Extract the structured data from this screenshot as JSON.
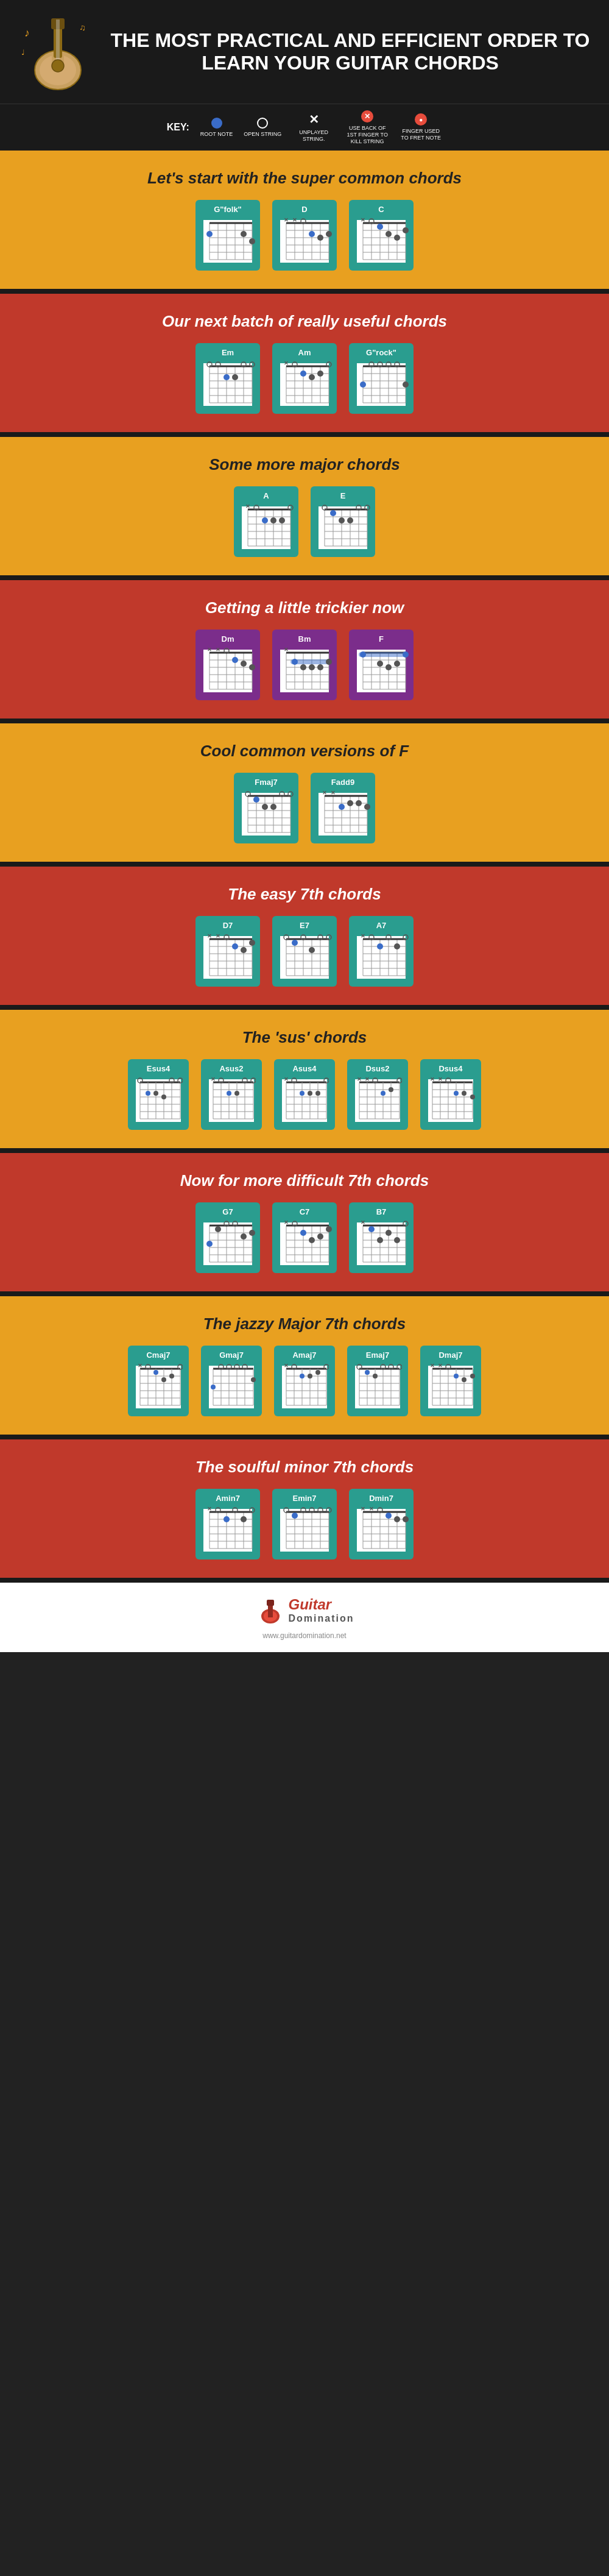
{
  "header": {
    "title": "THE MOST PRACTICAL AND EFFICIENT ORDER TO LEARN YOUR GUITAR CHORDS"
  },
  "key": {
    "label": "KEY:",
    "items": [
      {
        "symbol": "root",
        "label": "ROOT NOTE"
      },
      {
        "symbol": "open",
        "label": "OPEN STRING"
      },
      {
        "symbol": "X",
        "label": "UNPLAYED STRING."
      },
      {
        "symbol": "kill",
        "label": "USE BACK OF 1ST FINGER TO KILL STRING"
      },
      {
        "symbol": "fret",
        "label": "FINGER USED TO FRET NOTE"
      }
    ]
  },
  "sections": [
    {
      "id": "super-common",
      "bg": "yellow",
      "heading": "Let's start with the super common chords",
      "chords": [
        "G\"folk\"",
        "D",
        "C"
      ]
    },
    {
      "id": "really-useful",
      "bg": "red",
      "heading": "Our next batch of really useful chords",
      "chords": [
        "Em",
        "Am",
        "G\"rock\""
      ]
    },
    {
      "id": "major-chords",
      "bg": "yellow",
      "heading": "Some more major chords",
      "chords": [
        "A",
        "E"
      ]
    },
    {
      "id": "trickier",
      "bg": "red",
      "heading": "Getting a little trickier now",
      "chords": [
        "Dm",
        "Bm",
        "F"
      ]
    },
    {
      "id": "cool-f",
      "bg": "yellow",
      "heading": "Cool common versions of F",
      "chords": [
        "Fmaj7",
        "Fadd9"
      ]
    },
    {
      "id": "easy-7th",
      "bg": "red",
      "heading": "The easy 7th chords",
      "chords": [
        "D7",
        "E7",
        "A7"
      ]
    },
    {
      "id": "sus",
      "bg": "yellow",
      "heading": "The 'sus' chords",
      "chords": [
        "Esus4",
        "Asus2",
        "Asus4",
        "Dsus2",
        "Dsus4"
      ]
    },
    {
      "id": "difficult-7th",
      "bg": "red",
      "heading": "Now for more difficult 7th chords",
      "chords": [
        "G7",
        "C7",
        "B7"
      ]
    },
    {
      "id": "jazzy-major-7th",
      "bg": "yellow",
      "heading": "The jazzy Major 7th chords",
      "chords": [
        "Cmaj7",
        "Gmaj7",
        "Amaj7",
        "Emaj7",
        "Dmaj7"
      ]
    },
    {
      "id": "soulful-minor-7th",
      "bg": "red",
      "heading": "The soulful minor 7th chords",
      "chords": [
        "Amin7",
        "Emin7",
        "Dmin7"
      ]
    }
  ],
  "footer": {
    "brand": "Guitar",
    "sub": "Domination",
    "url": "www.guitardomination.net"
  }
}
